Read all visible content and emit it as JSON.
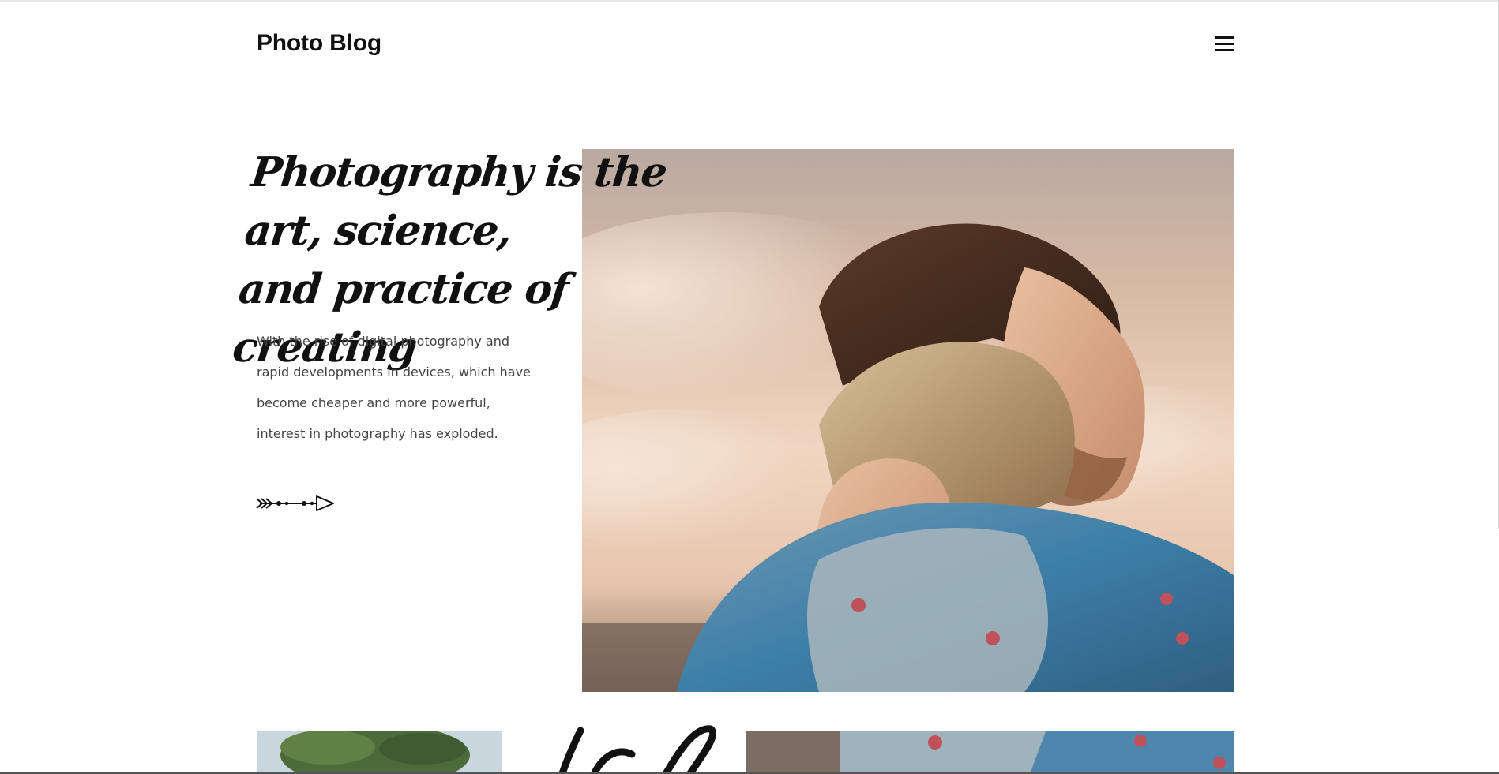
{
  "header": {
    "brand": "Photo Blog",
    "menu_icon": "hamburger-menu-icon"
  },
  "hero": {
    "headline_line1": "Photography is the art, science,",
    "headline_line2": "and practice of creating",
    "description": "With the rise of digital photography and rapid developments in devices, which have become cheaper and more powerful, interest in photography has exploded.",
    "arrow_icon": "decorative-arrow-icon",
    "photo": "couple-embrace-photo"
  },
  "gallery": {
    "thumb_left": "tree-thumbnail-photo",
    "thumb_right": "denim-jacket-thumbnail-photo"
  },
  "colors": {
    "text": "#111111",
    "body_text": "#444444",
    "background": "#ffffff"
  }
}
